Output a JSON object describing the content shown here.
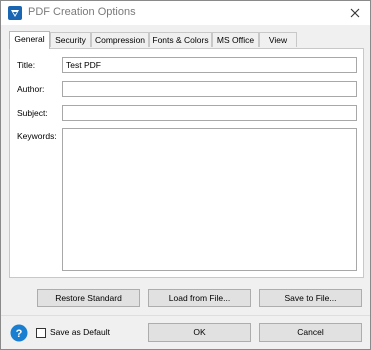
{
  "window": {
    "title": "PDF Creation Options",
    "close_glyph": "✕"
  },
  "tabs": [
    {
      "label": "General",
      "active": true
    },
    {
      "label": "Security",
      "active": false
    },
    {
      "label": "Compression",
      "active": false
    },
    {
      "label": "Fonts & Colors",
      "active": false
    },
    {
      "label": "MS Office",
      "active": false
    },
    {
      "label": "View",
      "active": false
    }
  ],
  "fields": {
    "title": {
      "label": "Title:",
      "value": "Test PDF"
    },
    "author": {
      "label": "Author:",
      "value": ""
    },
    "subject": {
      "label": "Subject:",
      "value": ""
    },
    "keywords": {
      "label": "Keywords:",
      "value": ""
    }
  },
  "buttons": {
    "restore": "Restore Standard",
    "load": "Load from File...",
    "save_file": "Save to File...",
    "ok": "OK",
    "cancel": "Cancel"
  },
  "footer": {
    "save_default_label": "Save as Default",
    "save_default_checked": false
  },
  "icons": {
    "app": "pdf-app-icon",
    "help": "help-icon",
    "close": "close-icon"
  },
  "colors": {
    "app_icon_blue": "#1a66b3",
    "help_blue": "#1a7fd0"
  }
}
